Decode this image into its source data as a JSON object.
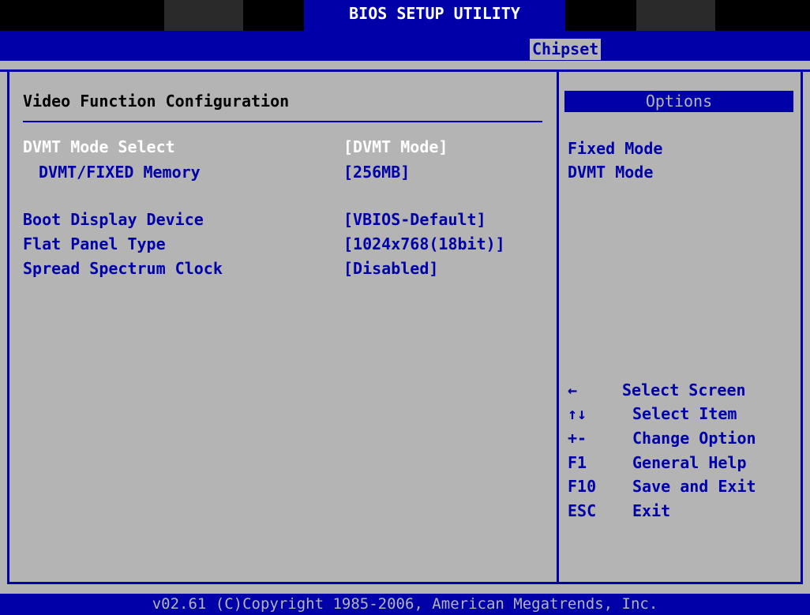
{
  "header": {
    "title": "BIOS SETUP UTILITY",
    "active_tab": "Chipset"
  },
  "main": {
    "heading": "Video Function Configuration",
    "settings": [
      {
        "label": "DVMT Mode Select",
        "value": "[DVMT Mode]"
      },
      {
        "label": "DVMT/FIXED Memory",
        "value": "[256MB]"
      },
      {
        "label": "Boot Display Device",
        "value": "[VBIOS-Default]"
      },
      {
        "label": "Flat Panel Type",
        "value": "[1024x768(18bit)]"
      },
      {
        "label": "Spread Spectrum Clock",
        "value": "[Disabled]"
      }
    ]
  },
  "options_panel": {
    "header": "Options",
    "items": [
      "Fixed Mode",
      "DVMT Mode"
    ]
  },
  "keys": [
    {
      "key": "←",
      "desc": "Select Screen"
    },
    {
      "key": "↑↓",
      "desc": "Select Item"
    },
    {
      "key": "+-",
      "desc": "Change Option"
    },
    {
      "key": "F1",
      "desc": "General Help"
    },
    {
      "key": "F10",
      "desc": "Save and Exit"
    },
    {
      "key": "ESC",
      "desc": "Exit"
    }
  ],
  "footer": "v02.61 (C)Copyright 1985-2006, American Megatrends, Inc.",
  "colors": {
    "background": "#b4b4b4",
    "bios_blue": "#0000a8",
    "selected_text": "#ffffff"
  }
}
